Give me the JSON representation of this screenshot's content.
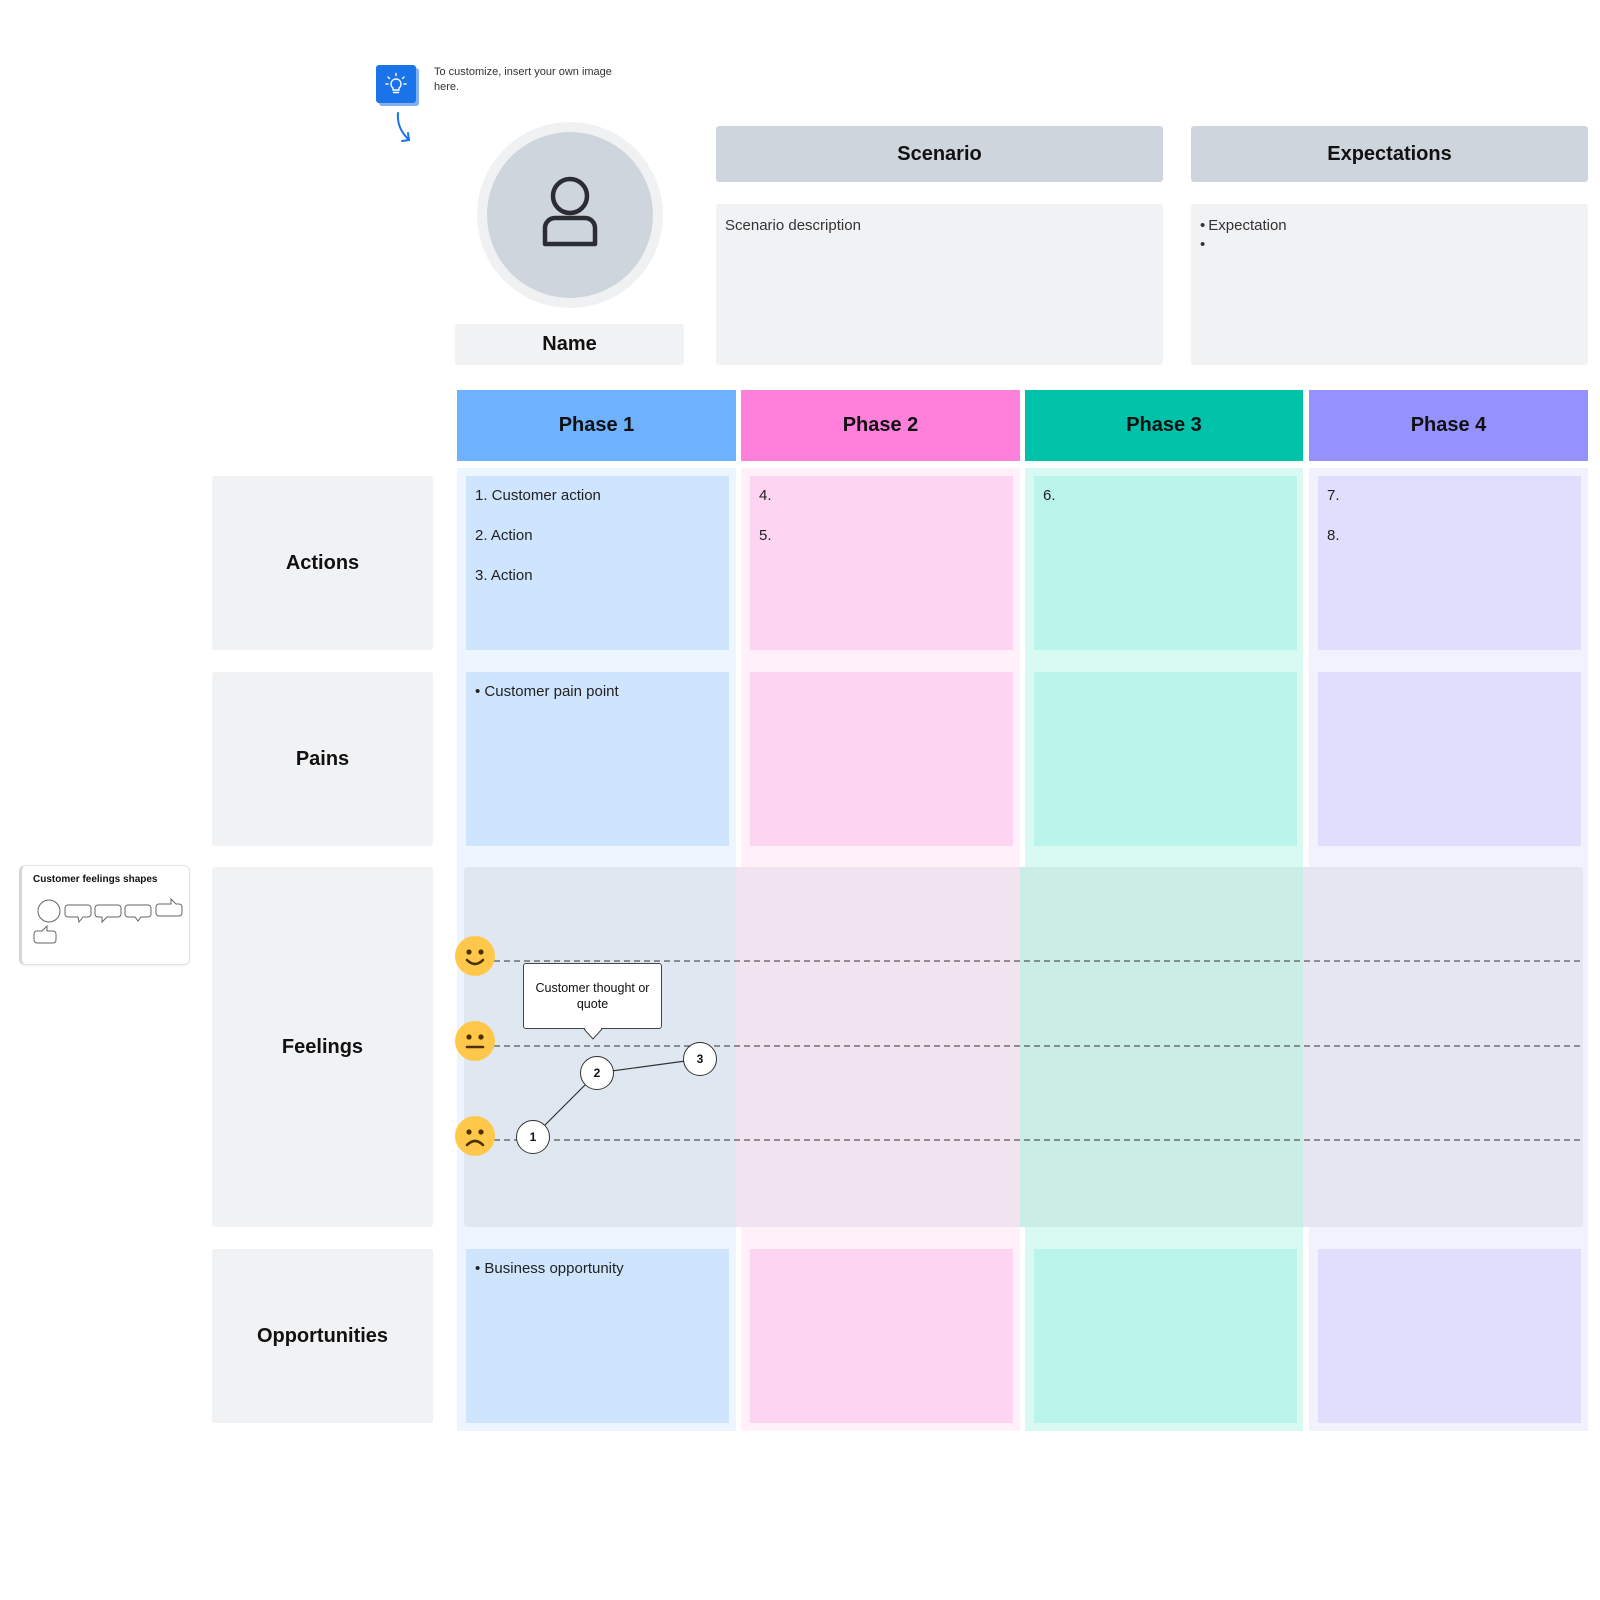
{
  "hint": {
    "icon": "lightbulb-icon",
    "text": "To customize, insert your own image here.",
    "arrow": "curved-arrow-down-icon"
  },
  "persona": {
    "avatar_icon": "user-icon",
    "name": "Name"
  },
  "scenario": {
    "title": "Scenario",
    "description": "Scenario description"
  },
  "expectations": {
    "title": "Expectations",
    "items": [
      "Expectation",
      ""
    ]
  },
  "phases": [
    {
      "label": "Phase 1",
      "header_color": "#6db1ff",
      "column_tint": "#edf5ff",
      "cell_color": "#cfe4fd"
    },
    {
      "label": "Phase 2",
      "header_color": "#ff80db",
      "column_tint": "#fff0fa",
      "cell_color": "#fdd5f3"
    },
    {
      "label": "Phase 3",
      "header_color": "#00c2a8",
      "column_tint": "#d9f9f3",
      "cell_color": "#baf4eb"
    },
    {
      "label": "Phase 4",
      "header_color": "#9592ff",
      "column_tint": "#f2f1fe",
      "cell_color": "#dfdefd"
    }
  ],
  "rows": {
    "actions": {
      "label": "Actions",
      "cells": [
        [
          "1. Customer action",
          "2. Action",
          "3. Action"
        ],
        [
          "4.",
          "5."
        ],
        [
          "6."
        ],
        [
          "7.",
          "8."
        ]
      ]
    },
    "pains": {
      "label": "Pains",
      "cells": [
        [
          "• Customer pain point"
        ],
        [],
        [],
        []
      ]
    },
    "feelings": {
      "label": "Feelings",
      "levels": [
        {
          "name": "happy",
          "icon": "happy-face-icon"
        },
        {
          "name": "neutral",
          "icon": "neutral-face-icon"
        },
        {
          "name": "sad",
          "icon": "sad-face-icon"
        }
      ],
      "points": [
        {
          "label": "1",
          "level": "sad"
        },
        {
          "label": "2",
          "level": "between neutral and sad"
        },
        {
          "label": "3",
          "level": "slightly below neutral"
        }
      ],
      "quote": "Customer thought or quote"
    },
    "opportunities": {
      "label": "Opportunities",
      "cells": [
        [
          "• Business opportunity"
        ],
        [],
        [],
        []
      ]
    }
  },
  "shapes_panel": {
    "title": "Customer feelings shapes",
    "shapes": [
      "circle-shape-icon",
      "speech-bubble-icon",
      "speech-bubble-icon",
      "speech-bubble-icon",
      "thumbs-up-icon",
      "thumbs-up-icon"
    ]
  }
}
